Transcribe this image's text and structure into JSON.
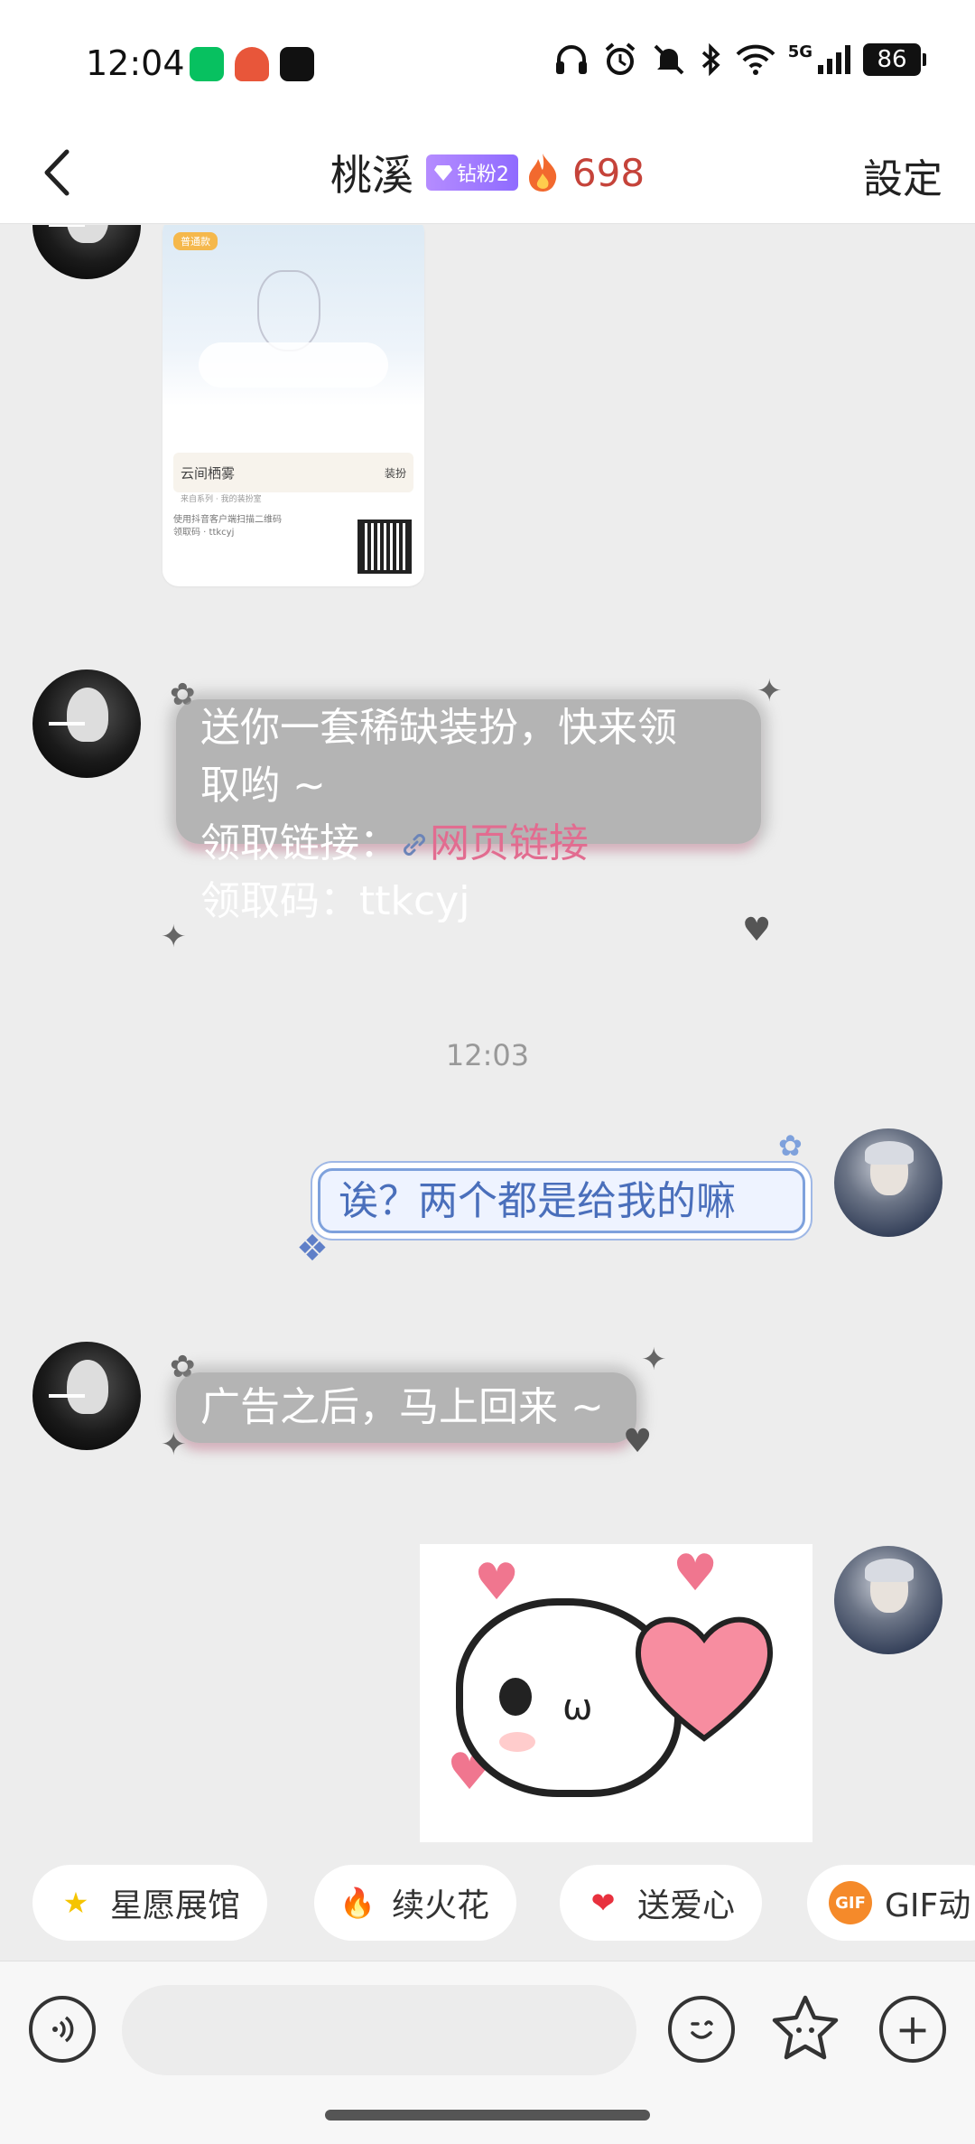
{
  "status_bar": {
    "time": "12:04",
    "battery": "86",
    "network": "5G",
    "icons": [
      "wechat-icon",
      "game-app-icon",
      "capcut-icon",
      "headphones-icon",
      "alarm-icon",
      "mute-icon",
      "bluetooth-icon",
      "wifi-icon",
      "signal-icon"
    ]
  },
  "header": {
    "back_icon": "chevron-left-icon",
    "title": "桃溪",
    "badge": "钻粉2",
    "streak_count": "698",
    "settings_label": "設定"
  },
  "messages": {
    "m2": {
      "line1": "送你一套稀缺装扮，快来领",
      "line2": "取哟 ~",
      "line3_label": "领取链接：",
      "line3_link": "网页链接",
      "line4": "领取码：ttkcyj"
    },
    "time_separator": "12:03",
    "m3": "诶？两个都是给我的嘛",
    "m4": "广告之后，马上回来 ~"
  },
  "card": {
    "tag": "普通款",
    "row_title": "云间栖雾",
    "row_right": "装扮",
    "row_sub": "来自系列 · 我的装扮室",
    "desc1": "使用抖音客户端扫描二维码",
    "desc2": "领取码 · ttkcyj"
  },
  "quick_actions": [
    {
      "label": "星愿展馆",
      "icon": "star-icon"
    },
    {
      "label": "续火花",
      "icon": "fire-icon"
    },
    {
      "label": "送爱心",
      "icon": "heart-icon"
    },
    {
      "label": "GIF动",
      "icon": "gif-icon"
    }
  ],
  "input_bar": {
    "voice_icon": "voice-icon",
    "emoji_icon": "emoji-icon",
    "sticker_icon": "sticker-icon",
    "plus_icon": "plus-icon"
  }
}
